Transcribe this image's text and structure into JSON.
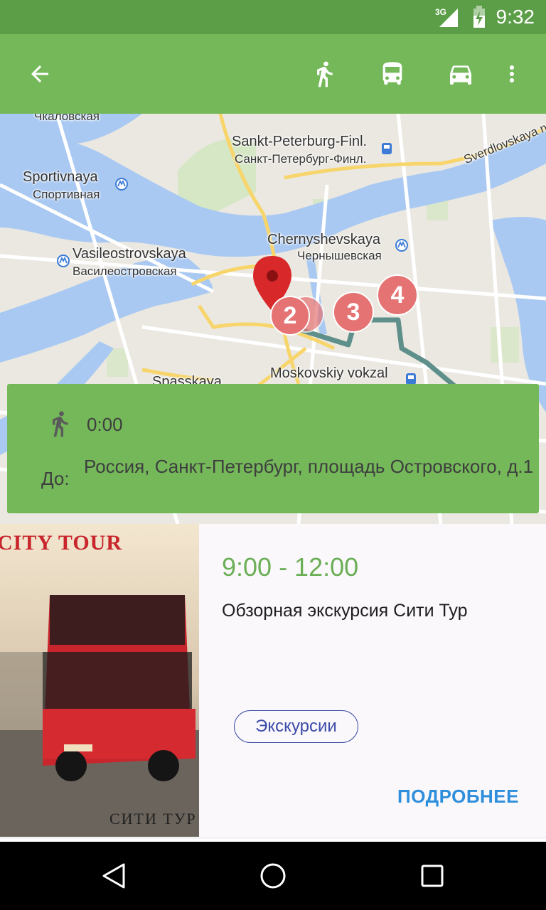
{
  "status_bar": {
    "time": "9:32",
    "network": "3G",
    "icons": [
      "signal-icon",
      "battery-icon"
    ]
  },
  "toolbar": {
    "icons": [
      "back-arrow-icon",
      "walk-icon",
      "bus-icon",
      "car-icon",
      "more-vert-icon"
    ]
  },
  "map": {
    "labels": [
      {
        "text": "Чкаловская",
        "size": "small"
      },
      {
        "text": "Sankt-Peterburg-Finl.",
        "size": "big"
      },
      {
        "text": "Санкт-Петербург-Финл.",
        "size": "small"
      },
      {
        "text": "Sverdlovskaya nab.",
        "size": "small"
      },
      {
        "text": "Sportivnaya",
        "size": "big"
      },
      {
        "text": "Спортивная",
        "size": "small"
      },
      {
        "text": "Chernyshevskaya",
        "size": "big"
      },
      {
        "text": "Чернышевская",
        "size": "small"
      },
      {
        "text": "Vasileostrovskaya",
        "size": "big"
      },
      {
        "text": "Василеостровская",
        "size": "small"
      },
      {
        "text": "Moskovskiy vokzal",
        "size": "big"
      },
      {
        "text": "Spasskaya",
        "size": "big"
      }
    ],
    "markers": [
      "2",
      "3",
      "4"
    ]
  },
  "route": {
    "duration": "0:00",
    "to_label": "До:",
    "destination": "Россия, Санкт-Петербург, площадь Островского, д.1"
  },
  "event": {
    "image_caption_top": "CITY TOUR",
    "image_caption_bottom": "СИТИ ТУР",
    "time": "9:00 - 12:00",
    "title": "Обзорная экскурсия Сити Тур",
    "tag": "Экскурсии",
    "more": "ПОДРОБНЕЕ"
  },
  "colors": {
    "status_bar": "#5c9e47",
    "app_bar": "#74b85a",
    "accent_time": "#6aae55",
    "chip": "#3b4ba8",
    "link": "#2d8fdc",
    "route_line": "#5f8f8a",
    "marker": "#e57373"
  }
}
